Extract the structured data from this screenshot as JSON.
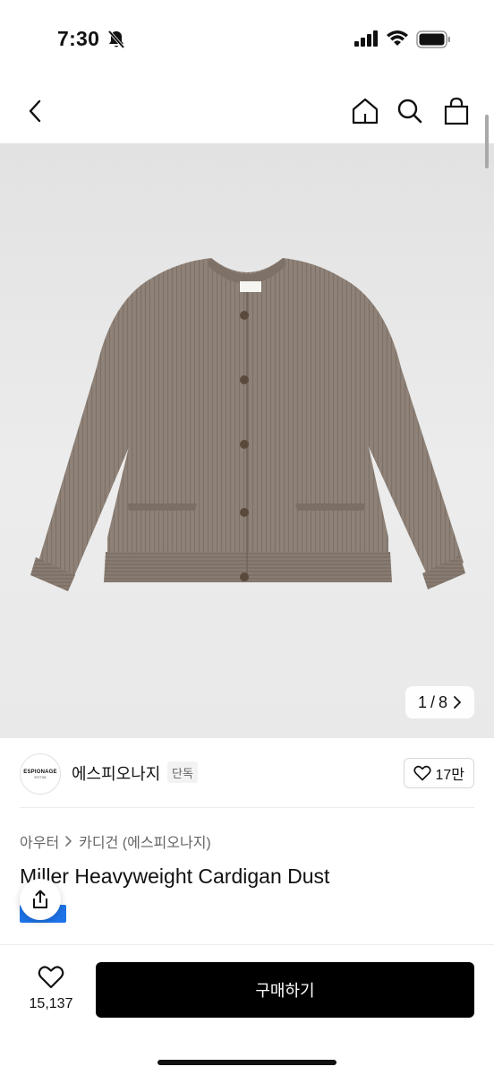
{
  "status_bar": {
    "time": "7:30"
  },
  "nav": {
    "back_icon": "chevron-left-icon",
    "home_icon": "home-icon",
    "search_icon": "search-icon",
    "bag_icon": "shopping-bag-icon"
  },
  "gallery": {
    "current": "1",
    "separator": "/",
    "total": "8",
    "next_icon": "chevron-right-icon",
    "image_alt": "Miller Heavyweight Cardigan Dust"
  },
  "brand": {
    "logo_text": "ESPIONAGE",
    "logo_subtext": "EST'08",
    "name": "에스피오나지",
    "badge": "단독",
    "like_count": "17만"
  },
  "breadcrumb": {
    "level1": "아우터",
    "level2": "카디건 (에스피오나지)"
  },
  "product": {
    "title": "Miller Heavyweight Cardigan Dust"
  },
  "bottom_bar": {
    "wish_count": "15,137",
    "buy_label": "구매하기"
  },
  "colors": {
    "buy_button": "#000000",
    "product_knit": "#8f8278",
    "accent_blue": "#1e73e8"
  }
}
